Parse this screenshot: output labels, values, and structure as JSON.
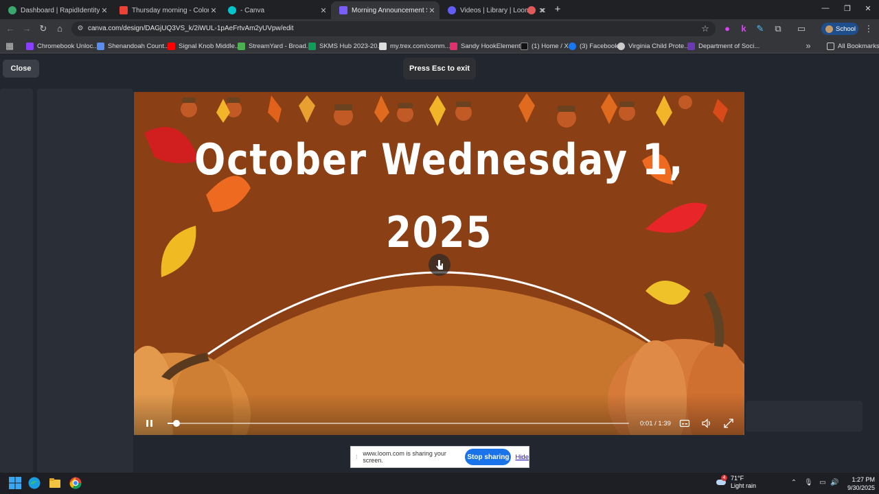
{
  "browser": {
    "tabs": [
      {
        "title": "Dashboard | RapidIdentity",
        "icon": "rapididentity-icon",
        "color": "#3aa76d"
      },
      {
        "title": "Thursday morning - Color Guard",
        "icon": "gmail-icon",
        "color": "#ea4335"
      },
      {
        "title": "- Canva",
        "icon": "canva-icon",
        "color": "#00c4cc"
      },
      {
        "title": "Morning Announcement Slides",
        "icon": "loom-play-icon",
        "color": "#7b5cff",
        "active": true
      },
      {
        "title": "Videos | Library | Loom",
        "icon": "loom-icon",
        "color": "#625df5"
      },
      {
        "title": "",
        "icon": "recording-icon",
        "color": "#e05a5a"
      }
    ],
    "new_tab_glyph": "+",
    "url": "canva.com/design/DAGjUQ3VS_k/2iWUL-1pAeFrtvAm2yUVpw/edit",
    "profile_label": "School",
    "bookmarks": [
      {
        "label": "Chromebook Unloc...",
        "color": "#8a3ffc"
      },
      {
        "label": "Shenandoah Count...",
        "color": "#5b8def"
      },
      {
        "label": "Signal Knob Middle...",
        "color": "#ff0000"
      },
      {
        "label": "StreamYard - Broad...",
        "color": "#4caf50"
      },
      {
        "label": "SKMS Hub 2023-20...",
        "color": "#0f9d58"
      },
      {
        "label": "my.trex.com/comm...",
        "color": "#dddddd"
      },
      {
        "label": "Sandy HookElement...",
        "color": "#e1306c"
      },
      {
        "label": "(1) Home / X",
        "color": "#111111"
      },
      {
        "label": "(3) Facebook",
        "color": "#1877f2"
      },
      {
        "label": "Virginia Child Prote...",
        "color": "#cccccc"
      },
      {
        "label": "Department of Soci...",
        "color": "#6a3ab2"
      }
    ],
    "all_bookmarks_label": "All Bookmarks"
  },
  "presentation": {
    "close_label": "Close",
    "esc_hint": "Press Esc to exit",
    "slide": {
      "line1": "October Wednesday 1,",
      "line2": "2025",
      "background_color": "#8a3f14",
      "hill_color": "#c8752e"
    },
    "video": {
      "current_time": "0:01",
      "total_time": "1:39",
      "progress_fraction": 0.013
    }
  },
  "loom": {
    "message": "www.loom.com is sharing your screen.",
    "stop_label": "Stop sharing",
    "hide_label": "Hide"
  },
  "taskbar": {
    "weather_temp": "71°F",
    "weather_desc": "Light rain",
    "weather_badge": "4",
    "time": "1:27 PM",
    "date": "9/30/2025"
  }
}
